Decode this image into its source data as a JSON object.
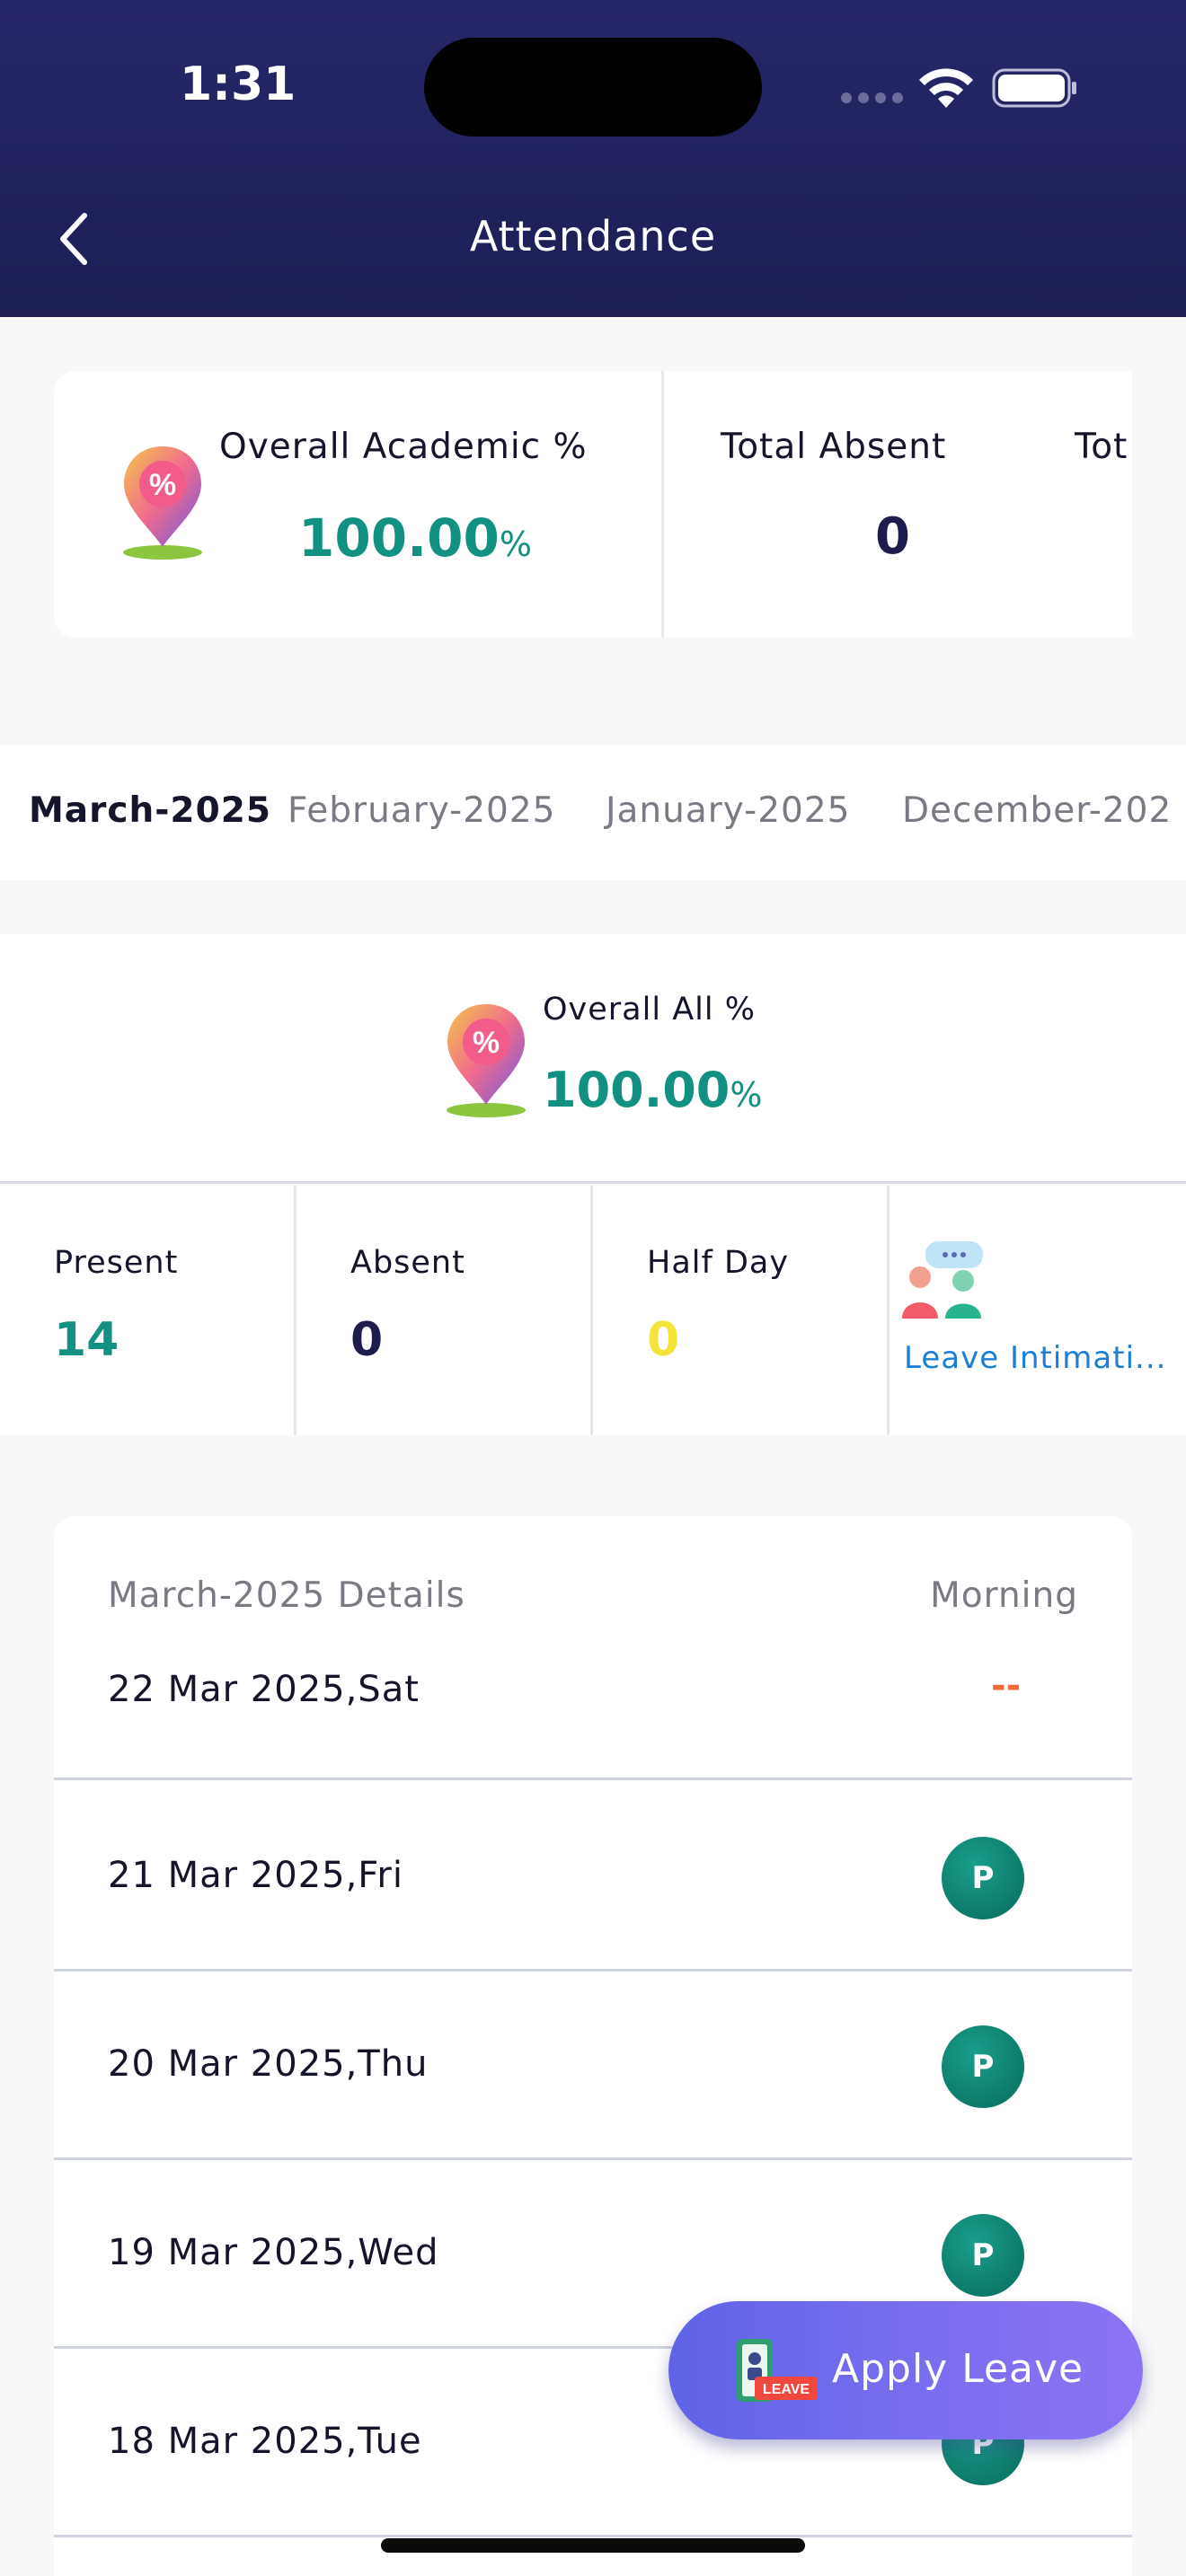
{
  "status_bar": {
    "time": "1:31"
  },
  "header": {
    "title": "Attendance"
  },
  "summary": {
    "academic_label": "Overall Academic %",
    "academic_value": "100.00",
    "academic_unit": "%",
    "absent_label": "Total Absent",
    "absent_value": "0",
    "next_label_partial": "Tot"
  },
  "months": [
    "March-2025",
    "February-2025",
    "January-2025",
    "December-202"
  ],
  "overall": {
    "label": "Overall All %",
    "value": "100.00",
    "unit": "%"
  },
  "stats": {
    "present_label": "Present",
    "present_value": "14",
    "absent_label": "Absent",
    "absent_value": "0",
    "halfday_label": "Half Day",
    "halfday_value": "0",
    "leave_label": "Leave Intimati..."
  },
  "details": {
    "header": "March-2025 Details",
    "column": "Morning",
    "rows": [
      {
        "date": "22 Mar 2025,Sat",
        "status": "--"
      },
      {
        "date": "21 Mar 2025,Fri",
        "status": "P"
      },
      {
        "date": "20 Mar 2025,Thu",
        "status": "P"
      },
      {
        "date": "19 Mar 2025,Wed",
        "status": "P"
      },
      {
        "date": "18 Mar 2025,Tue",
        "status": "P"
      }
    ]
  },
  "apply_button": {
    "label": "Apply Leave",
    "icon_text": "LEAVE"
  },
  "colors": {
    "header": "#262769",
    "accent_teal": "#129183",
    "halfday_yellow": "#f4e43a",
    "link_blue": "#1b7fd6",
    "none_orange": "#f26b3a"
  }
}
